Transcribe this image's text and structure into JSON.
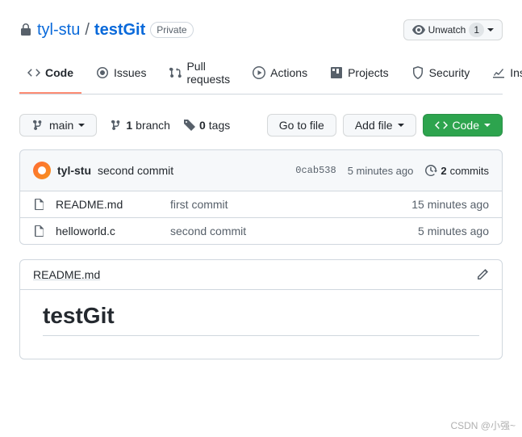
{
  "repo": {
    "owner": "tyl-stu",
    "name": "testGit",
    "visibility": "Private"
  },
  "watch": {
    "label": "Unwatch",
    "count": "1"
  },
  "tabs": [
    {
      "label": "Code"
    },
    {
      "label": "Issues"
    },
    {
      "label": "Pull requests"
    },
    {
      "label": "Actions"
    },
    {
      "label": "Projects"
    },
    {
      "label": "Security"
    },
    {
      "label": "Insights"
    }
  ],
  "branch": {
    "label": "main"
  },
  "stats": {
    "branches_count": "1",
    "branches_label": "branch",
    "tags_count": "0",
    "tags_label": "tags"
  },
  "buttons": {
    "go_to_file": "Go to file",
    "add_file": "Add file",
    "code": "Code"
  },
  "latest_commit": {
    "author": "tyl-stu",
    "message": "second commit",
    "sha": "0cab538",
    "time": "5 minutes ago",
    "commits_count": "2",
    "commits_label": "commits"
  },
  "files": [
    {
      "name": "README.md",
      "commit": "first commit",
      "time": "15 minutes ago"
    },
    {
      "name": "helloworld.c",
      "commit": "second commit",
      "time": "5 minutes ago"
    }
  ],
  "readme": {
    "filename": "README.md",
    "heading": "testGit"
  },
  "watermark": "CSDN @小强~"
}
